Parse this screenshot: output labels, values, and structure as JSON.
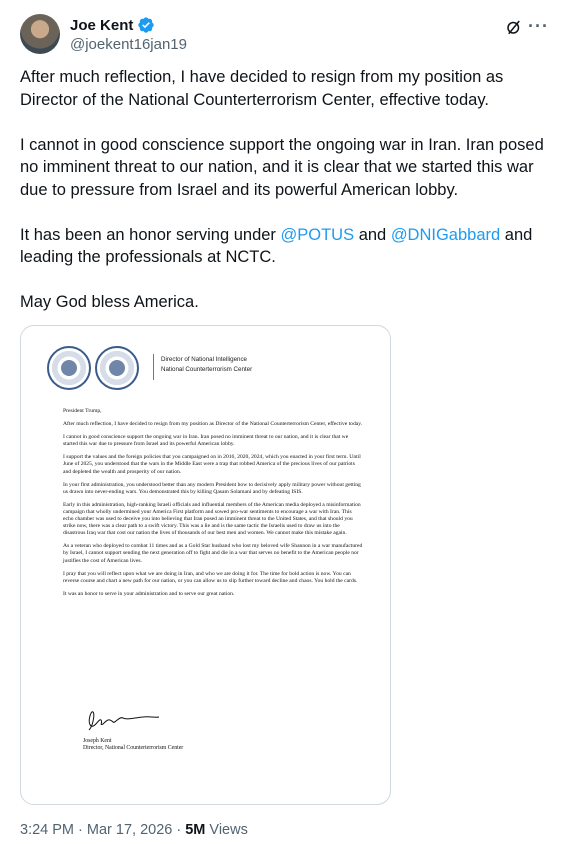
{
  "author": {
    "name": "Joe Kent",
    "handle": "@joekent16jan19"
  },
  "tweet": {
    "paragraphs": {
      "p1": "After much reflection, I have decided to resign from my position as Director of the National Counterterrorism Center, effective today.",
      "p2": "I cannot in good conscience support the ongoing war in Iran. Iran posed no imminent threat to our nation, and it is clear that we started this war due to pressure from Israel and its powerful American lobby.",
      "p3_pre": "It has been an honor serving under ",
      "p3_mention1": "@POTUS",
      "p3_mid": " and ",
      "p3_mention2": "@DNIGabbard",
      "p3_post": " and leading the professionals at NCTC.",
      "p4": "May God bless America."
    }
  },
  "letter": {
    "letterhead_line1": "Director of National Intelligence",
    "letterhead_line2": "National Counterterrorism Center",
    "salutation": "President Trump,",
    "paras": [
      "After much reflection, I have decided to resign from my position as Director of the National Counterterrorism Center, effective today.",
      "I cannot in good conscience support the ongoing war in Iran. Iran posed no imminent threat to our nation, and it is clear that we started this war due to pressure from Israel and its powerful American lobby.",
      "I support the values and the foreign policies that you campaigned on in 2016, 2020, 2024, which you enacted in your first term. Until June of 2025, you understood that the wars in the Middle East were a trap that robbed America of the precious lives of our patriots and depleted the wealth and prosperity of our nation.",
      "In your first administration, you understood better than any modern President how to decisively apply military power without getting us drawn into never-ending wars. You demonstrated this by killing Qasam Solamani and by defeating ISIS.",
      "Early in this administration, high-ranking Israeli officials and influential members of the American media deployed a misinformation campaign that wholly undermined your America First platform and sowed pro-war sentiments to encourage a war with Iran. This echo chamber was used to deceive you into believing that Iran posed an imminent threat to the United States, and that should you strike now, there was a clear path to a swift victory. This was a lie and is the same tactic the Israelis used to draw us into the disastrous Iraq war that cost our nation the lives of thousands of our best men and women. We cannot make this mistake again.",
      "As a veteran who deployed to combat 11 times and as a Gold Star husband who lost my beloved wife Shannon in a war manufactured by Israel, I cannot support sending the next generation off to fight and die in a war that serves no benefit to the American people nor justifies the cost of American lives.",
      "I pray that you will reflect upon what we are doing in Iran, and who we are doing it for. The time for bold action is now. You can reverse course and chart a new path for our nation, or you can allow us to slip further toward decline and chaos. You hold the cards.",
      "It was an honor to serve in your administration and to serve our great nation."
    ],
    "signer_name": "Joseph Kent",
    "signer_title": "Director, National Counterterrorism Center"
  },
  "meta": {
    "time": "3:24 PM",
    "separator": " · ",
    "date": "Mar 17, 2026",
    "views_count": "5M",
    "views_label": " Views"
  },
  "icons": {
    "verified": "verified-badge-icon",
    "grok": "grok-icon",
    "more": "more-options-icon"
  },
  "colors": {
    "accent": "#1d9bf0",
    "text": "#0f1419",
    "secondary": "#536471"
  }
}
